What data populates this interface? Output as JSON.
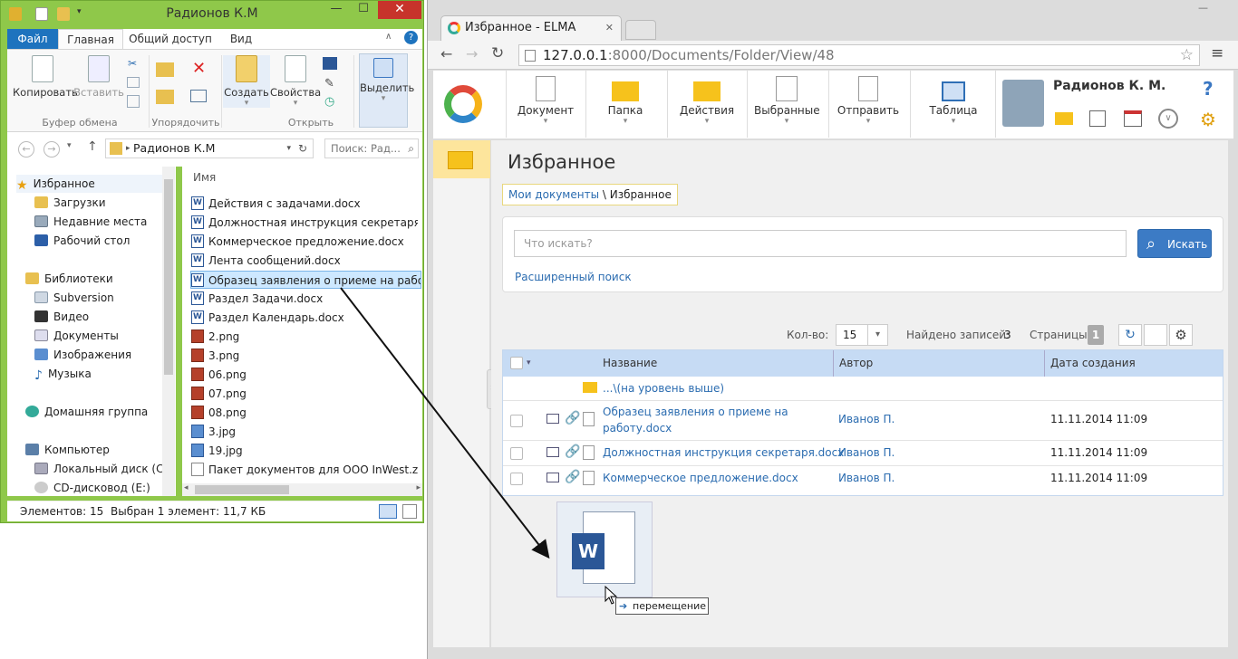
{
  "explorer": {
    "title": "Радионов К.М",
    "ribbon_tabs": [
      "Файл",
      "Главная",
      "Общий доступ",
      "Вид"
    ],
    "ribbon": {
      "copy": "Копировать",
      "paste": "Вставить",
      "create": "Создать",
      "properties": "Свойства",
      "select": "Выделить",
      "group_clipboard": "Буфер обмена",
      "group_organize": "Упорядочить",
      "group_open": "Открыть"
    },
    "path": "Радионов К.М",
    "search_placeholder": "Поиск: Рад...",
    "nav_items": [
      "Избранное",
      "Загрузки",
      "Недавние места",
      "Рабочий стол",
      "Библиотеки",
      "Subversion",
      "Видео",
      "Документы",
      "Изображения",
      "Музыка",
      "Домашняя группа",
      "Компьютер",
      "Локальный диск (C:)",
      "CD-дисковод (E:)"
    ],
    "column_name": "Имя",
    "files": [
      "Действия с задачами.docx",
      "Должностная инструкция секретаря.do...",
      "Коммерческое предложение.docx",
      "Лента сообщений.docx",
      "Образец заявления о приеме на работ...",
      "Раздел Задачи.docx",
      "Раздел Календарь.docx",
      "2.png",
      "3.png",
      "06.png",
      "07.png",
      "08.png",
      "3.jpg",
      "19.jpg",
      "Пакет документов для ООО InWest.zip"
    ],
    "status_count": "Элементов: 15",
    "status_selected": "Выбран 1 элемент: 11,7 КБ"
  },
  "browser": {
    "tab_title": "Избранное - ELMA",
    "url": "127.0.0.1:8000/Documents/Folder/View/48",
    "url_host": "127.0.0.1",
    "url_rest": ":8000/Documents/Folder/View/48"
  },
  "elma": {
    "toolbar": [
      "Документ",
      "Папка",
      "Действия",
      "Выбранные",
      "Отправить",
      "Таблица"
    ],
    "user_name": "Радионов К. М.",
    "page_title": "Избранное",
    "breadcrumb_root": "Мои документы",
    "breadcrumb_sep": " \\ ",
    "breadcrumb_current": "Избранное",
    "search_placeholder": "Что искать?",
    "search_button": "Искать",
    "advanced_search": "Расширенный поиск",
    "pager": {
      "count_label": "Кол-во:",
      "count_value": "15",
      "found_label": "Найдено записей:",
      "found_value": "3",
      "pages_label": "Страницы:",
      "page_value": "1"
    },
    "columns": [
      "Название",
      "Автор",
      "Дата создания"
    ],
    "up_level": "...\\(на уровень выше)",
    "rows": [
      {
        "name": "Образец заявления о приеме на работу.docx",
        "name_line1": "Образец заявления о приеме на",
        "name_line2": "работу.docx",
        "author": "Иванов П.",
        "date": "11.11.2014 11:09"
      },
      {
        "name": "Должностная инструкция секретаря.docx",
        "author": "Иванов П.",
        "date": "11.11.2014 11:09"
      },
      {
        "name": "Коммерческое предложение.docx",
        "author": "Иванов П.",
        "date": "11.11.2014 11:09"
      }
    ],
    "drag_label": "перемещение"
  },
  "colors": {
    "explorer_frame": "#8fc84a",
    "accent_blue": "#3c7bc5",
    "link": "#2b6cb0",
    "grid_header": "#c6dbf4",
    "close_red": "#c7332b"
  }
}
